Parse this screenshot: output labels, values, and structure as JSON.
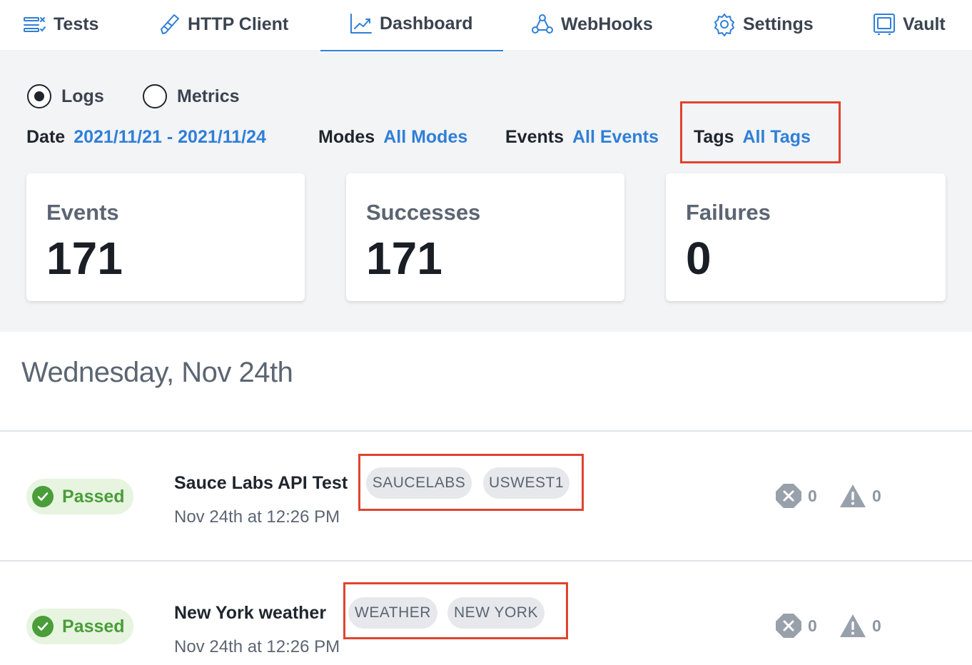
{
  "nav": {
    "tabs": [
      {
        "label": "Tests",
        "icon": "tests-icon"
      },
      {
        "label": "HTTP Client",
        "icon": "pencil-icon"
      },
      {
        "label": "Dashboard",
        "icon": "chart-line-icon",
        "active": true
      },
      {
        "label": "WebHooks",
        "icon": "webhooks-icon"
      },
      {
        "label": "Settings",
        "icon": "gear-icon"
      },
      {
        "label": "Vault",
        "icon": "vault-icon"
      }
    ]
  },
  "view_toggle": {
    "options": [
      {
        "label": "Logs",
        "selected": true
      },
      {
        "label": "Metrics",
        "selected": false
      }
    ]
  },
  "filters": {
    "date": {
      "label": "Date",
      "value": "2021/11/21 - 2021/11/24"
    },
    "modes": {
      "label": "Modes",
      "value": "All Modes"
    },
    "events": {
      "label": "Events",
      "value": "All Events"
    },
    "tags": {
      "label": "Tags",
      "value": "All Tags"
    }
  },
  "stats": [
    {
      "label": "Events",
      "value": "171"
    },
    {
      "label": "Successes",
      "value": "171"
    },
    {
      "label": "Failures",
      "value": "0"
    }
  ],
  "day_heading": "Wednesday, Nov 24th",
  "logs": [
    {
      "status": "Passed",
      "title": "Sauce Labs API Test",
      "time": "Nov 24th at 12:26 PM",
      "tags": [
        "SAUCELABS",
        "USWEST1"
      ],
      "errors": "0",
      "warnings": "0"
    },
    {
      "status": "Passed",
      "title": "New York weather",
      "time": "Nov 24th at 12:26 PM",
      "tags": [
        "WEATHER",
        "NEW YORK"
      ],
      "errors": "0",
      "warnings": "0"
    }
  ],
  "colors": {
    "accent": "#2f7fd8",
    "highlight": "#e0432f",
    "passed": "#4a9d38",
    "passed_bg": "#e6f4e0",
    "filter_bg": "#f3f4f6"
  }
}
